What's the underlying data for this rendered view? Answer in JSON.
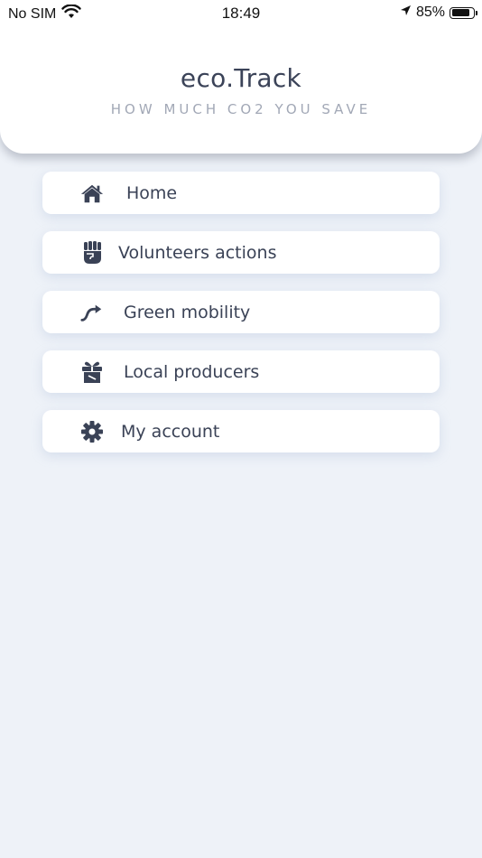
{
  "status_bar": {
    "carrier": "No SIM",
    "time": "18:49",
    "battery": "85%",
    "battery_level": 0.85
  },
  "header": {
    "title": "eco.Track",
    "subtitle": "HOW MUCH CO2 YOU SAVE"
  },
  "menu": {
    "items": [
      {
        "label": "Home",
        "icon": "home-icon"
      },
      {
        "label": "Volunteers actions",
        "icon": "fist-icon"
      },
      {
        "label": "Green mobility",
        "icon": "route-icon"
      },
      {
        "label": "Local producers",
        "icon": "gift-icon"
      },
      {
        "label": "My account",
        "icon": "gear-icon"
      }
    ]
  },
  "colors": {
    "background": "#eef2f8",
    "card": "#ffffff",
    "text": "#3a4256",
    "subtitle": "#a2a8b6"
  }
}
